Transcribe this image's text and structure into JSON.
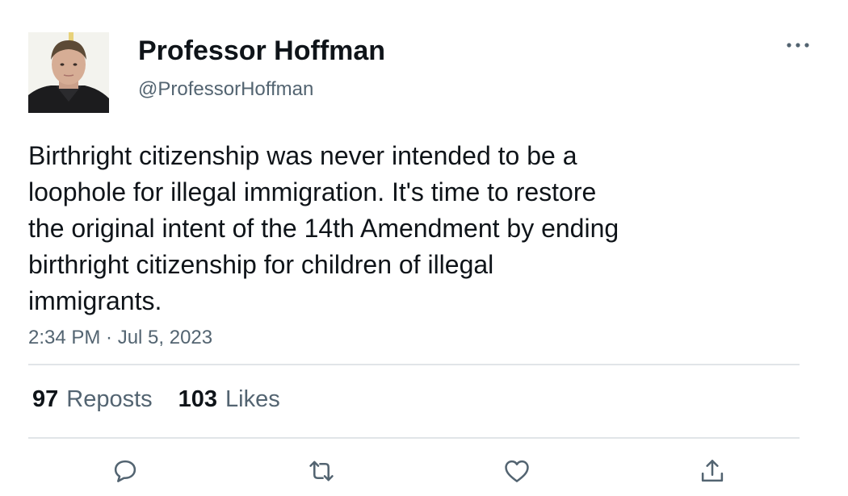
{
  "author": {
    "name": "Professor Hoffman",
    "handle": "@ProfessorHoffman",
    "avatar_icon": "profile-photo"
  },
  "tweet": {
    "text": "Birthright citizenship was never intended to be a\nloophole for illegal immigration. It's time to restore\nthe original intent of the 14th Amendment by ending\nbirthright citizenship for children of illegal\nimmigrants.",
    "timestamp": "2:34 PM · Jul 5, 2023"
  },
  "stats": {
    "reposts_count": "97",
    "reposts_label": "Reposts",
    "likes_count": "103",
    "likes_label": "Likes"
  },
  "actions": [
    {
      "icon": "reply-icon"
    },
    {
      "icon": "repost-icon"
    },
    {
      "icon": "like-icon"
    },
    {
      "icon": "share-icon"
    }
  ],
  "colors": {
    "text_primary": "#0f1419",
    "text_secondary": "#536471",
    "divider": "#e1e5e8",
    "icon": "#536471"
  }
}
